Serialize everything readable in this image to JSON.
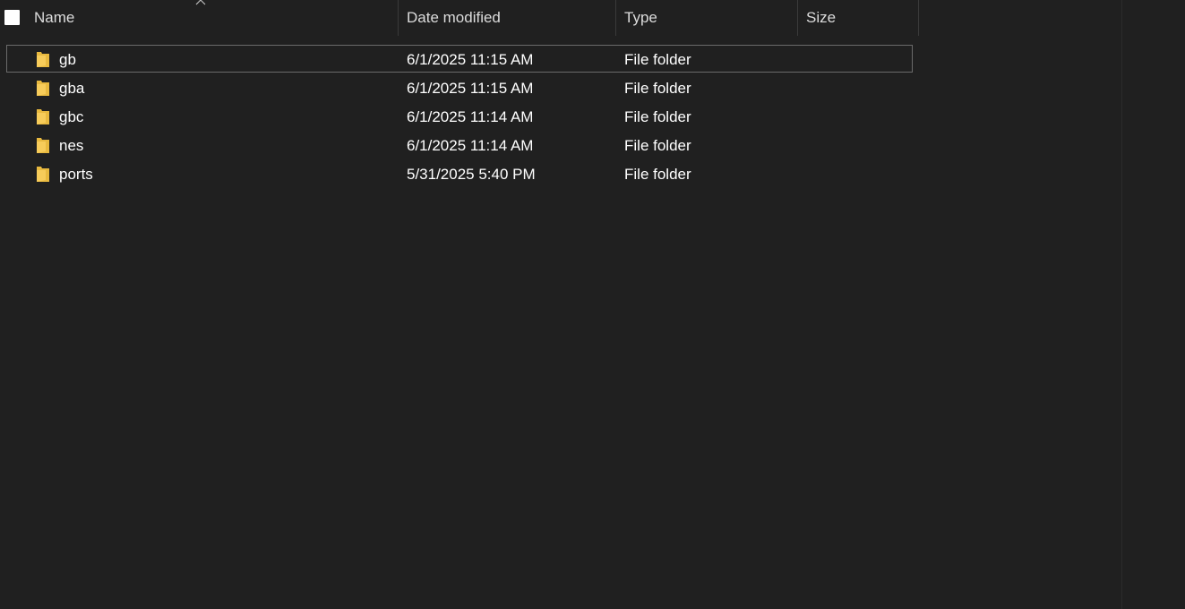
{
  "columns": {
    "name": "Name",
    "date_modified": "Date modified",
    "type": "Type",
    "size": "Size"
  },
  "sort": {
    "column": "name",
    "direction": "ascending",
    "icon": "sort-up-caret-icon"
  },
  "colors": {
    "background": "#202020",
    "folder": "#f7cc5a",
    "focus_border": "#6b6b6b"
  },
  "files": [
    {
      "name": "gb",
      "date_modified": "6/1/2025 11:15 AM",
      "type": "File folder",
      "size": "",
      "icon": "folder-icon",
      "focused": true
    },
    {
      "name": "gba",
      "date_modified": "6/1/2025 11:15 AM",
      "type": "File folder",
      "size": "",
      "icon": "folder-icon"
    },
    {
      "name": "gbc",
      "date_modified": "6/1/2025 11:14 AM",
      "type": "File folder",
      "size": "",
      "icon": "folder-icon"
    },
    {
      "name": "nes",
      "date_modified": "6/1/2025 11:14 AM",
      "type": "File folder",
      "size": "",
      "icon": "folder-icon"
    },
    {
      "name": "ports",
      "date_modified": "5/31/2025 5:40 PM",
      "type": "File folder",
      "size": "",
      "icon": "folder-icon"
    }
  ]
}
